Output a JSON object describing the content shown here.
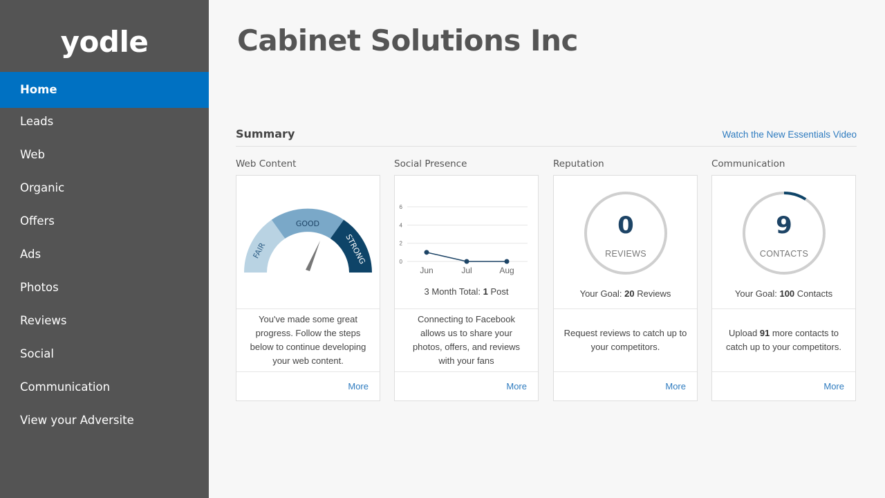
{
  "sidebar": {
    "logo": "yodle",
    "items": [
      {
        "label": "Home",
        "active": true
      },
      {
        "label": "Leads"
      },
      {
        "label": "Web"
      },
      {
        "label": "Organic"
      },
      {
        "label": "Offers"
      },
      {
        "label": "Ads"
      },
      {
        "label": "Photos"
      },
      {
        "label": "Reviews"
      },
      {
        "label": "Social"
      },
      {
        "label": "Communication"
      },
      {
        "label": "View your Adversite"
      }
    ]
  },
  "header": {
    "company": "Cabinet Solutions Inc"
  },
  "summary": {
    "title": "Summary",
    "video_link": "Watch the New Essentials Video"
  },
  "cards": {
    "web_content": {
      "heading": "Web Content",
      "gauge": {
        "segments": [
          "FAIR",
          "GOOD",
          "STRONG"
        ],
        "colors": [
          "#b9d3e3",
          "#7aa8c8",
          "#0e4468"
        ],
        "needle_segment": "GOOD"
      },
      "description": "You've made some great progress. Follow the steps below to continue developing your web content.",
      "more": "More"
    },
    "social_presence": {
      "heading": "Social Presence",
      "total_prefix": "3 Month Total:",
      "total_value": "1",
      "total_suffix": "Post",
      "description": "Connecting to Facebook allows us to share your photos, offers, and reviews with your fans",
      "more": "More"
    },
    "reputation": {
      "heading": "Reputation",
      "count": "0",
      "count_label": "REVIEWS",
      "goal_prefix": "Your Goal:",
      "goal_value": "20",
      "goal_suffix": "Reviews",
      "progress": 0.0,
      "description": "Request reviews to catch up to your competitors.",
      "more": "More"
    },
    "communication": {
      "heading": "Communication",
      "count": "9",
      "count_label": "CONTACTS",
      "goal_prefix": "Your Goal:",
      "goal_value": "100",
      "goal_suffix": "Contacts",
      "progress": 0.09,
      "desc_prefix": "Upload",
      "desc_value": "91",
      "desc_suffix": "more contacts to catch up to your competitors.",
      "more": "More"
    }
  },
  "chart_data": {
    "type": "line",
    "categories": [
      "Jun",
      "Jul",
      "Aug"
    ],
    "values": [
      1,
      0,
      0
    ],
    "yticks": [
      0,
      2,
      4,
      6
    ],
    "ylim": [
      0,
      6
    ],
    "color": "#1d4466"
  }
}
